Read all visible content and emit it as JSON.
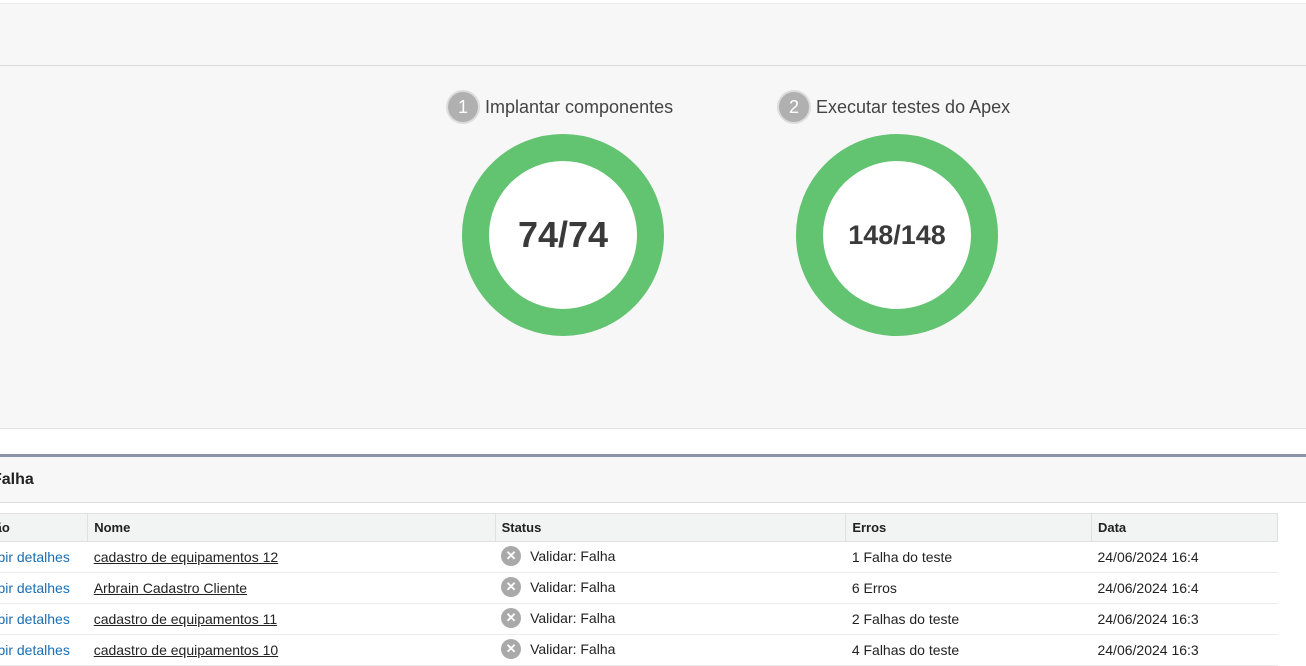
{
  "steps": [
    {
      "number": "1",
      "title": "Implantar componentes",
      "completed": 74,
      "total": 74,
      "label": "74/74"
    },
    {
      "number": "2",
      "title": "Executar testes do Apex",
      "completed": 148,
      "total": 148,
      "label": "148/148"
    }
  ],
  "colors": {
    "progress": "#62c370",
    "step_badge": "#b0b0b0",
    "link": "#1a6eb3"
  },
  "section": {
    "title": "Falha"
  },
  "table": {
    "headers": {
      "action": "Ação",
      "name": "Nome",
      "status": "Status",
      "errors": "Erros",
      "date": "Data"
    },
    "rows": [
      {
        "action": "Exibir detalhes",
        "name": "cadastro de equipamentos 12",
        "status": "Validar: Falha",
        "errors": "1 Falha do teste",
        "date": "24/06/2024 16:4"
      },
      {
        "action": "Exibir detalhes",
        "name": "Arbrain Cadastro Cliente",
        "status": "Validar: Falha",
        "errors": "6 Erros",
        "date": "24/06/2024 16:4"
      },
      {
        "action": "Exibir detalhes",
        "name": "cadastro de equipamentos 11",
        "status": "Validar: Falha",
        "errors": "2 Falhas do teste",
        "date": "24/06/2024 16:3"
      },
      {
        "action": "Exibir detalhes",
        "name": "cadastro de equipamentos 10",
        "status": "Validar: Falha",
        "errors": "4 Falhas do teste",
        "date": "24/06/2024 16:3"
      }
    ]
  }
}
